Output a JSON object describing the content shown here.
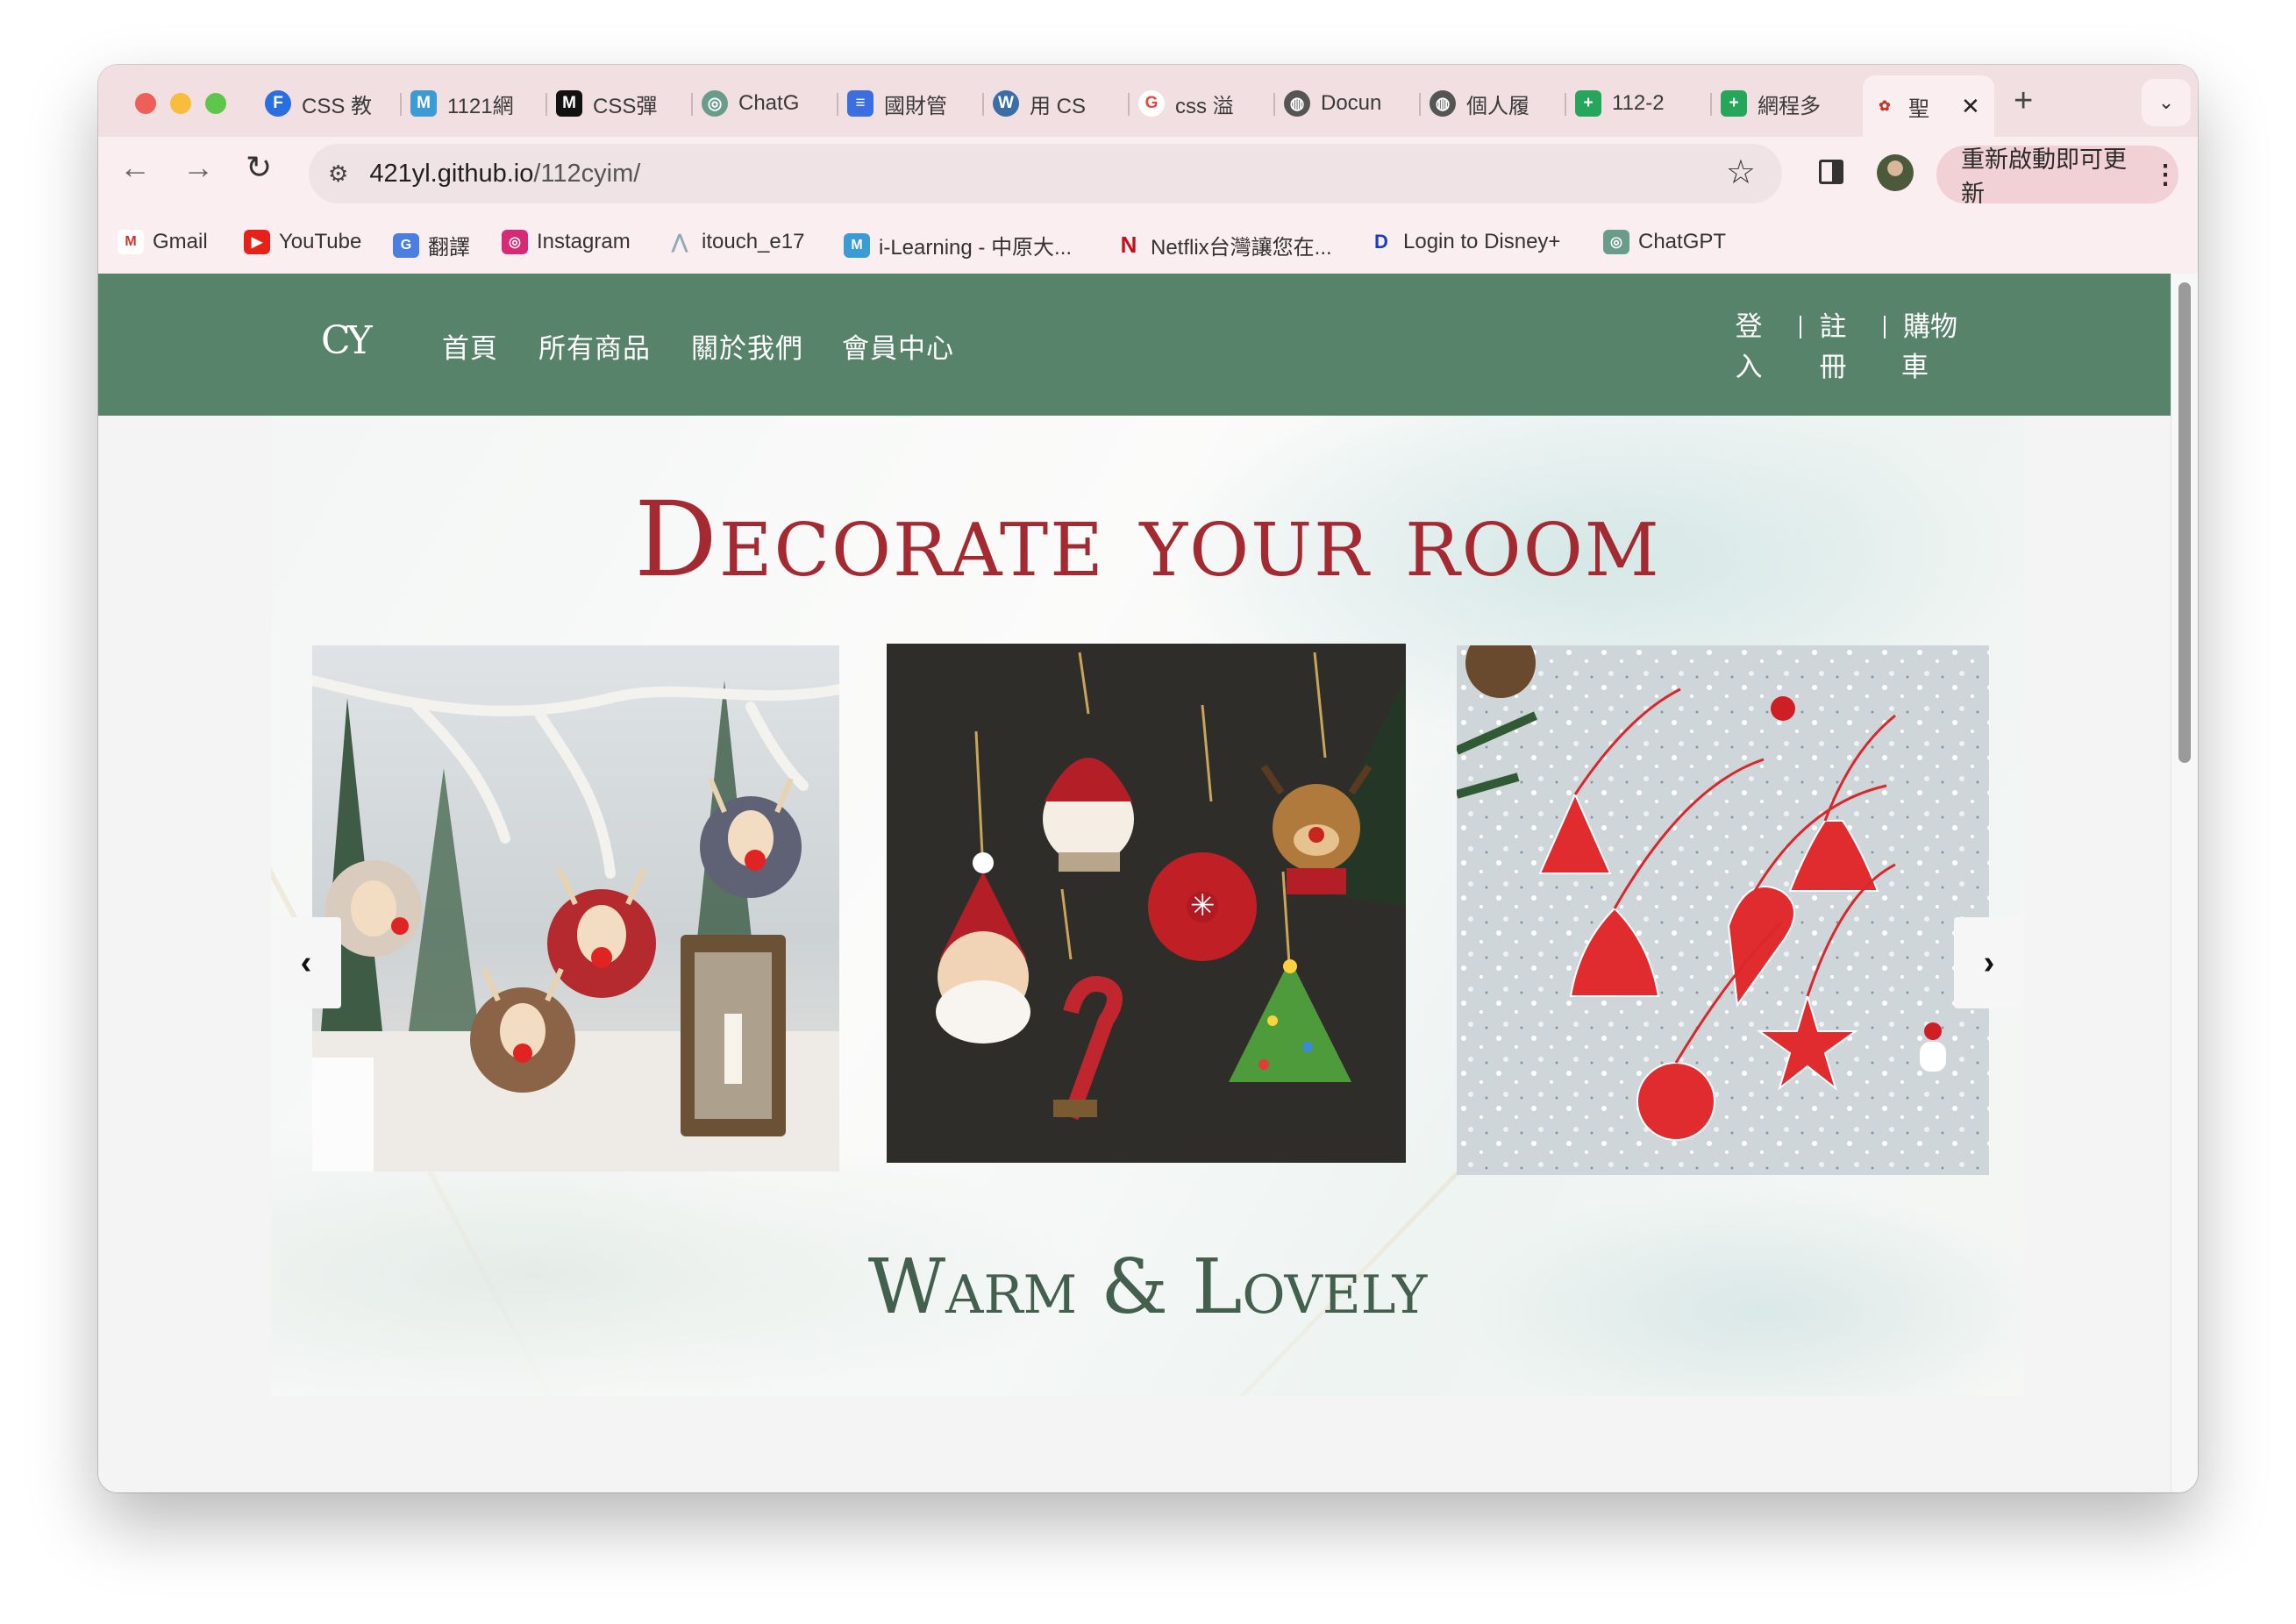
{
  "browser": {
    "tabs": [
      {
        "title": "CSS 教",
        "favicon": "F",
        "color": "#2a6fe0"
      },
      {
        "title": "1121網",
        "favicon": "M",
        "color": "#3a9bd5"
      },
      {
        "title": "CSS彈",
        "favicon": "M",
        "color": "#111111"
      },
      {
        "title": "ChatG",
        "favicon": "◎",
        "color": "#6a9c8c"
      },
      {
        "title": "國財管",
        "favicon": "≡",
        "color": "#3b6fe0"
      },
      {
        "title": "用 CS",
        "favicon": "W",
        "color": "#3a6ea5"
      },
      {
        "title": "css 溢",
        "favicon": "G",
        "color": "#e9473b"
      },
      {
        "title": "Docun",
        "favicon": "◍",
        "color": "#555555"
      },
      {
        "title": "個人履",
        "favicon": "◍",
        "color": "#555555"
      },
      {
        "title": "112-2",
        "favicon": "+",
        "color": "#26a65b"
      },
      {
        "title": "網程多",
        "favicon": "+",
        "color": "#26a65b"
      }
    ],
    "active_tab": {
      "title": "聖",
      "close_glyph": "✕"
    },
    "new_tab_glyph": "+",
    "tab_menu_glyph": "⌄",
    "url_host": "421yl.github.io",
    "url_path": "/112cyim/",
    "update_button": "重新啟動即可更新",
    "bookmarks": [
      {
        "label": "Gmail",
        "icon": "M",
        "color": "#d93025"
      },
      {
        "label": "YouTube",
        "icon": "▶",
        "color": "#e62117"
      },
      {
        "label": "翻譯",
        "icon": "G",
        "color": "#4a7fe0"
      },
      {
        "label": "Instagram",
        "icon": "◎",
        "color": "#d62976"
      },
      {
        "label": "itouch_e17",
        "icon": "⋀",
        "color": "#8fa9b8"
      },
      {
        "label": "i-Learning - 中原大...",
        "icon": "M",
        "color": "#3a9bd5"
      },
      {
        "label": "Netflix台灣讓您在...",
        "icon": "N",
        "color": "#c11119"
      },
      {
        "label": "Login to Disney+",
        "icon": "D",
        "color": "#1b3ebf"
      },
      {
        "label": "ChatGPT",
        "icon": "◎",
        "color": "#6a9c8c"
      }
    ]
  },
  "site": {
    "logo_text": "CY",
    "nav": [
      "首頁",
      "所有商品",
      "關於我們",
      "會員中心"
    ],
    "user_links": [
      {
        "line1": "登",
        "line2": "入"
      },
      {
        "line1": "註",
        "line2": "冊"
      },
      {
        "line1": "購物",
        "line2": "車"
      }
    ],
    "header_color": "#58836b",
    "hero_title": "Decorate your room",
    "hero_subtitle": "Warm & Lovely",
    "carousel_prev": "‹",
    "carousel_next": "›",
    "title_color": "#a42a32",
    "subtitle_color": "#43604e"
  }
}
